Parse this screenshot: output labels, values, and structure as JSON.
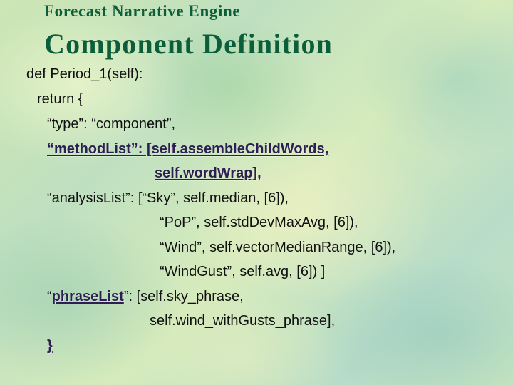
{
  "slide": {
    "subtitle": "Forecast Narrative Engine",
    "title": "Component Definition"
  },
  "code": {
    "line1": "def Period_1(self):",
    "line2": "return {",
    "line3": "“type”: “component”,",
    "line4": "“methodList”: [self.assembleChildWords,",
    "line5": "self.wordWrap],",
    "line6": "“analysisList”: [“Sky”, self.median, [6]),",
    "line7": "“PoP”, self.stdDevMaxAvg, [6]),",
    "line8": "“Wind”, self.vectorMedianRange, [6]),",
    "line9": "“WindGust”, self.avg, [6]) ]",
    "line10_open_quote": "“",
    "line10_key": "phraseList",
    "line10_rest": "”: [self.sky_phrase,",
    "line11": "self.wind_withGusts_phrase],",
    "line12": "}"
  },
  "colors": {
    "title": "#0c5e3a",
    "code_text": "#111111",
    "highlight": "#2d1f52"
  }
}
